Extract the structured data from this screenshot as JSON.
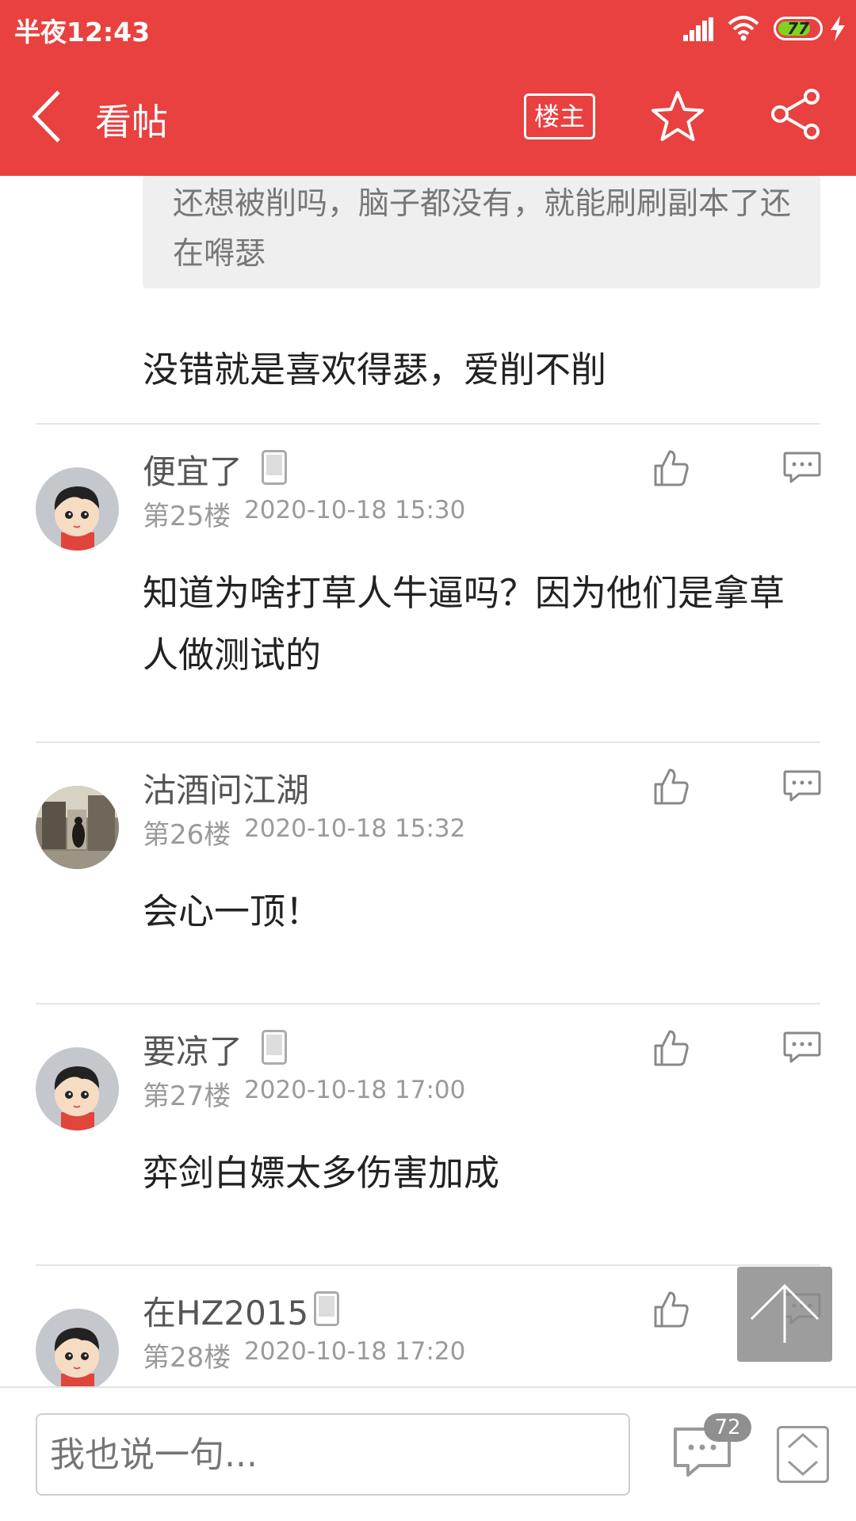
{
  "status_bar": {
    "time": "半夜12:43",
    "battery": "77"
  },
  "header": {
    "title": "看帖",
    "op_badge": "楼主"
  },
  "quoted": {
    "text": "还想被削吗，脑子都没有，就能刷刷副本了还在嘚瑟"
  },
  "previous_post": {
    "body": "没错就是喜欢得瑟，爱削不削"
  },
  "posts": [
    {
      "user": "便宜了",
      "floor": "第25楼",
      "date": "2020-10-18 15:30",
      "body": "知道为啥打草人牛逼吗？因为他们是拿草人做测试的",
      "avatar": "cartoon-avatar",
      "device": true
    },
    {
      "user": "沽酒问江湖",
      "floor": "第26楼",
      "date": "2020-10-18 15:32",
      "body": "会心一顶！",
      "avatar": "photo-avatar",
      "device": false
    },
    {
      "user": "要凉了",
      "floor": "第27楼",
      "date": "2020-10-18 17:00",
      "body": "弈剑白嫖太多伤害加成",
      "avatar": "cartoon-avatar",
      "device": true
    },
    {
      "user": "在HZ2015",
      "floor": "第28楼",
      "date": "2020-10-18 17:20",
      "body": "",
      "avatar": "cartoon-avatar",
      "device": true
    }
  ],
  "bottom_bar": {
    "placeholder": "我也说一句...",
    "comment_count": "72"
  },
  "colors": {
    "accent": "#e8413f"
  }
}
